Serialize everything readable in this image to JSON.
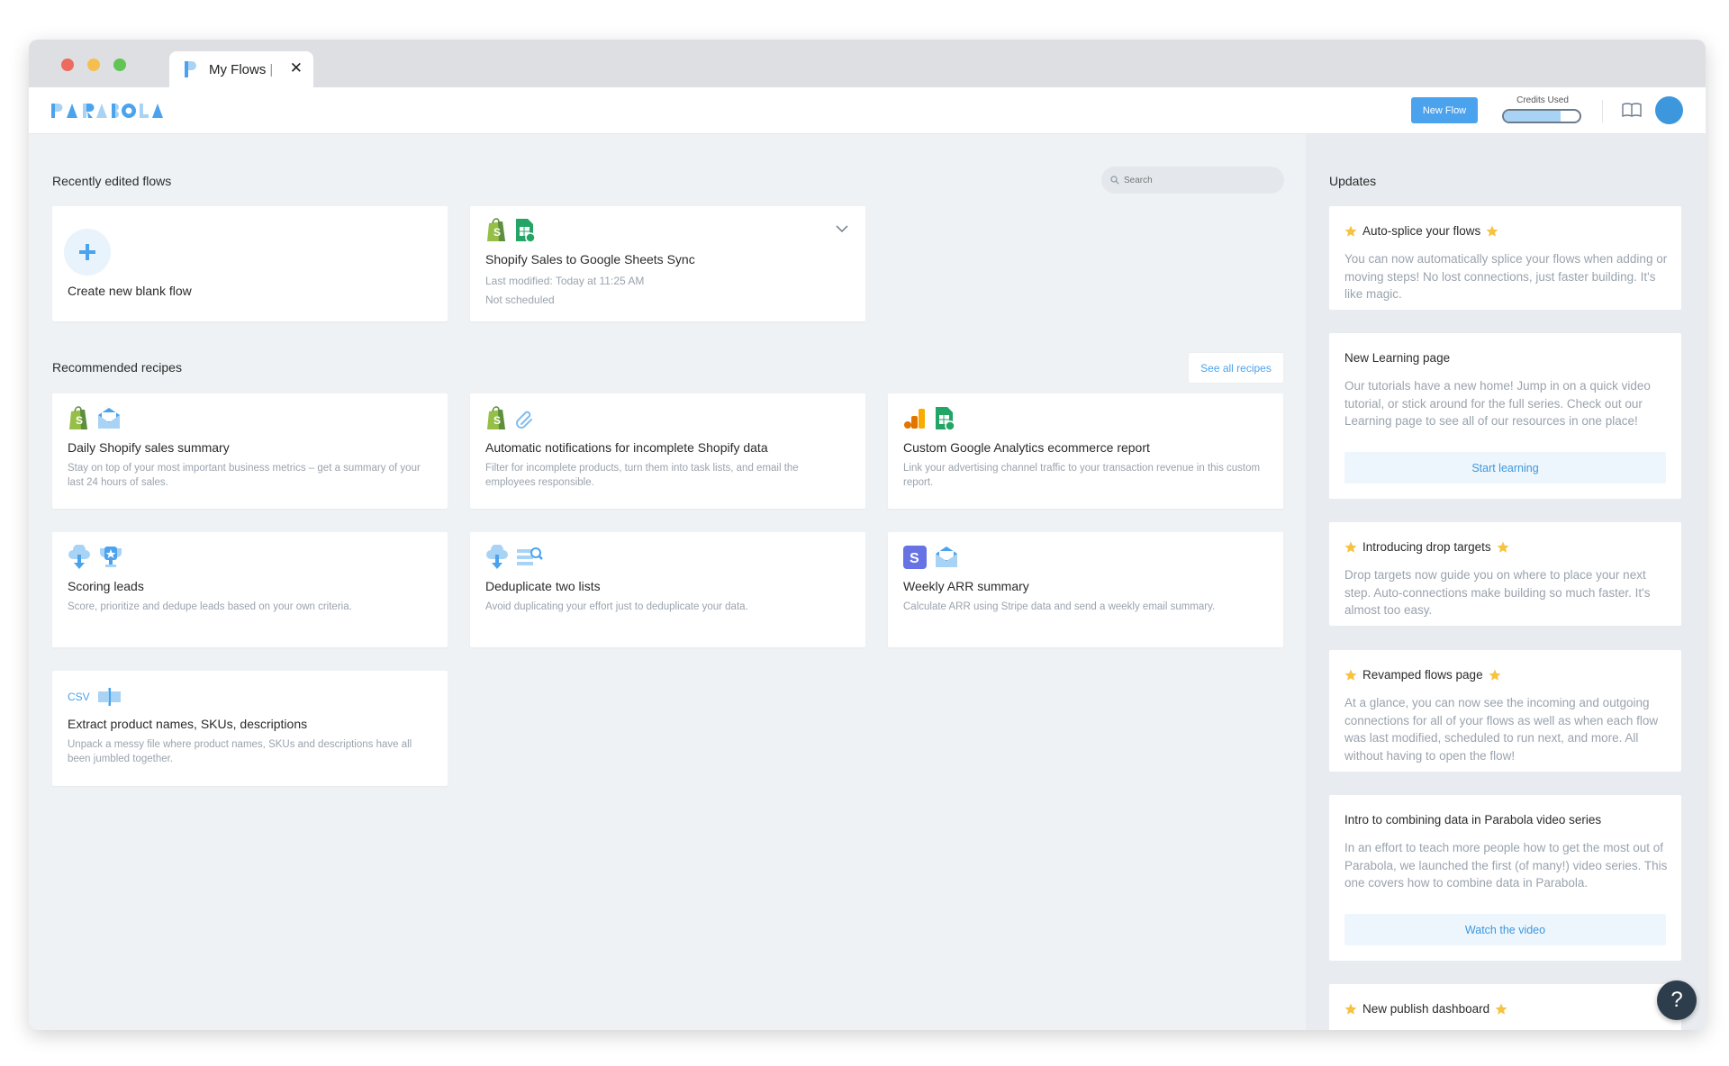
{
  "browser": {
    "tab_title": "My Flows",
    "tab_separator": "|",
    "close_glyph": "✕"
  },
  "navbar": {
    "brand": "PARABOLA",
    "new_flow_label": "New Flow",
    "credits_label": "Credits Used",
    "credits_used_fraction": 0.75,
    "accent_color": "#4ba3ee"
  },
  "main": {
    "recent_title": "Recently edited flows",
    "search_placeholder": "Search",
    "new_flow_card_label": "Create new blank flow",
    "recent_flows": [
      {
        "title": "Shopify Sales to Google Sheets Sync",
        "modified": "Last modified: Today at 11:25 AM",
        "schedule": "Not scheduled",
        "icons": [
          "shopify-icon",
          "google-sheets-icon"
        ]
      }
    ],
    "recipes_title": "Recommended recipes",
    "see_all_label": "See all recipes",
    "recipes": [
      {
        "title": "Daily Shopify sales summary",
        "desc": "Stay on top of your most important business metrics – get a summary of your last 24 hours of sales.",
        "icons": [
          "shopify-icon",
          "email-icon"
        ]
      },
      {
        "title": "Automatic notifications for incomplete Shopify data",
        "desc": "Filter for incomplete products, turn them into task lists, and email the employees responsible.",
        "icons": [
          "shopify-icon",
          "paperclip-icon"
        ]
      },
      {
        "title": "Custom Google Analytics ecommerce report",
        "desc": "Link your advertising channel traffic to your transaction revenue in this custom report.",
        "icons": [
          "google-analytics-icon",
          "google-sheets-icon"
        ]
      },
      {
        "title": "Scoring leads",
        "desc": "Score, prioritize and dedupe leads based on your own criteria.",
        "icons": [
          "cloud-download-icon",
          "trophy-icon"
        ]
      },
      {
        "title": "Deduplicate two lists",
        "desc": "Avoid duplicating your effort just to deduplicate your data.",
        "icons": [
          "cloud-download-icon",
          "list-search-icon"
        ]
      },
      {
        "title": "Weekly ARR summary",
        "desc": "Calculate ARR using Stripe data and send a weekly email summary.",
        "icons": [
          "stripe-icon",
          "email-icon"
        ]
      },
      {
        "title": "Extract product names, SKUs, descriptions",
        "desc": "Unpack a messy file where product names, SKUs and descriptions have all been jumbled together.",
        "icons": [
          "csv-icon",
          "split-column-icon"
        ],
        "csv_text": "CSV"
      }
    ]
  },
  "updates": {
    "title": "Updates",
    "items": [
      {
        "title": "Auto-splice your flows",
        "starred": true,
        "body": "You can now automatically splice your flows when adding or moving steps! No lost connections, just faster building. It's like magic."
      },
      {
        "title": "New Learning page",
        "starred": false,
        "body": "Our tutorials have a new home! Jump in on a quick video tutorial, or stick around for the full series. Check out our Learning page to see all of our resources in one place!",
        "button": "Start learning"
      },
      {
        "title": "Introducing drop targets",
        "starred": true,
        "body": "Drop targets now guide you on where to place your next step. Auto-connections make building so much faster. It's almost too easy."
      },
      {
        "title": "Revamped flows page",
        "starred": true,
        "body": "At a glance, you can now see the incoming and outgoing connections for all of your flows as well as when each flow was last modified, scheduled to run next, and more. All without having to open the flow!"
      },
      {
        "title": "Intro to combining data in Parabola video series",
        "starred": false,
        "body": "In an effort to teach more people how to get the most out of Parabola, we launched the first (of many!) video series. This one covers how to combine data in Parabola.",
        "button": "Watch the video"
      },
      {
        "title": "New publish dashboard",
        "starred": true,
        "body": ""
      }
    ]
  },
  "help": {
    "label": "?"
  }
}
